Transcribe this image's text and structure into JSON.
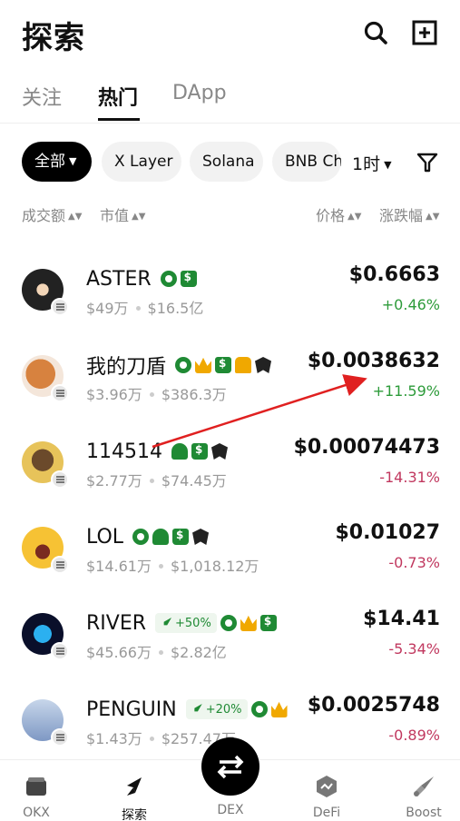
{
  "header": {
    "title": "探索"
  },
  "tabs": [
    {
      "label": "关注",
      "active": false
    },
    {
      "label": "热门",
      "active": true
    },
    {
      "label": "DApp",
      "active": false
    }
  ],
  "filters": {
    "chips": [
      "全部",
      "X Layer",
      "Solana",
      "BNB Chain"
    ],
    "time": "1时"
  },
  "sort": {
    "volume": "成交额",
    "market_cap": "市值",
    "price": "价格",
    "change": "涨跌幅"
  },
  "tokens": [
    {
      "name": "ASTER",
      "volume": "$49万",
      "market_cap": "$16.5亿",
      "price": "$0.6663",
      "change": "+0.46%",
      "direction": "up",
      "badges": [
        "circle-icon",
        "moneybag-icon"
      ],
      "boost": ""
    },
    {
      "name": "我的刀盾",
      "volume": "$3.96万",
      "market_cap": "$386.3万",
      "price": "$0.0038632",
      "change": "+11.59%",
      "direction": "up",
      "badges": [
        "circle-icon",
        "crown-icon",
        "moneybag-icon",
        "people-icon",
        "eagle-icon"
      ],
      "boost": ""
    },
    {
      "name": "114514",
      "volume": "$2.77万",
      "market_cap": "$74.45万",
      "price": "$0.00074473",
      "change": "-14.31%",
      "direction": "down",
      "badges": [
        "chef-icon",
        "moneybag-icon",
        "eagle-icon"
      ],
      "boost": ""
    },
    {
      "name": "LOL",
      "volume": "$14.61万",
      "market_cap": "$1,018.12万",
      "price": "$0.01027",
      "change": "-0.73%",
      "direction": "down",
      "badges": [
        "circle-icon",
        "chef-icon",
        "moneybag-icon",
        "eagle-icon"
      ],
      "boost": ""
    },
    {
      "name": "RIVER",
      "volume": "$45.66万",
      "market_cap": "$2.82亿",
      "price": "$14.41",
      "change": "-5.34%",
      "direction": "down",
      "badges": [
        "circle-icon",
        "crown-icon",
        "moneybag-icon"
      ],
      "boost": "+50%"
    },
    {
      "name": "PENGUIN",
      "volume": "$1.43万",
      "market_cap": "$257.47万",
      "price": "$0.0025748",
      "change": "-0.89%",
      "direction": "down",
      "badges": [
        "circle-icon",
        "crown-icon"
      ],
      "boost": "+20%"
    }
  ],
  "nav": [
    {
      "label": "OKX"
    },
    {
      "label": "探索"
    },
    {
      "label": "DEX"
    },
    {
      "label": "DeFi"
    },
    {
      "label": "Boost"
    }
  ],
  "colors": {
    "up": "#2d9b3a",
    "down": "#c1385f",
    "badge_green": "#1f8a34",
    "annotation_red": "#e02020"
  }
}
